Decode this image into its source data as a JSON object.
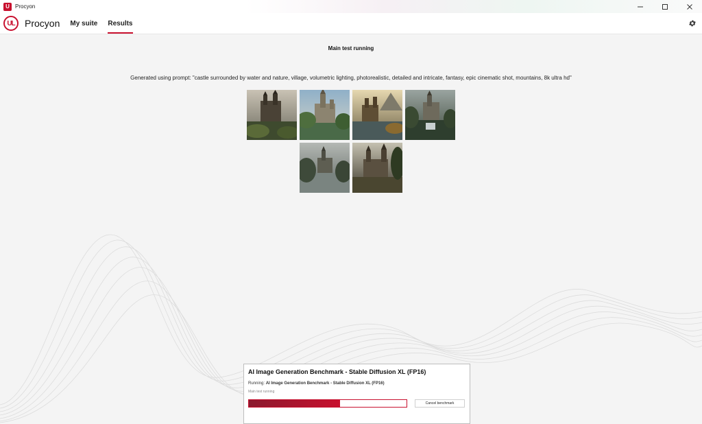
{
  "window": {
    "title": "Procyon"
  },
  "header": {
    "brand": "Procyon",
    "nav": [
      {
        "label": "My suite",
        "active": false
      },
      {
        "label": "Results",
        "active": true
      }
    ]
  },
  "main": {
    "status_title": "Main test running",
    "prompt_text": "Generated using prompt: \"castle surrounded by water and nature, village, volumetric lighting, photorealistic, detailed and intricate, fantasy, epic cinematic shot, mountains, 8k ultra hd\""
  },
  "panel": {
    "title": "AI Image Generation Benchmark - Stable Diffusion XL (FP16)",
    "running_label": "Running:",
    "running_value": "AI Image Generation Benchmark - Stable Diffusion XL (FP16)",
    "sub_status": "Main test running",
    "progress_fraction": 0.58,
    "cancel_label": "Cancel benchmark"
  },
  "colors": {
    "accent": "#c8102e",
    "progress_dark": "#8a1a2e"
  },
  "icons": [
    "app-logo-icon",
    "ul-logo-icon",
    "settings-gear-icon",
    "minimize-icon",
    "maximize-icon",
    "close-icon"
  ]
}
